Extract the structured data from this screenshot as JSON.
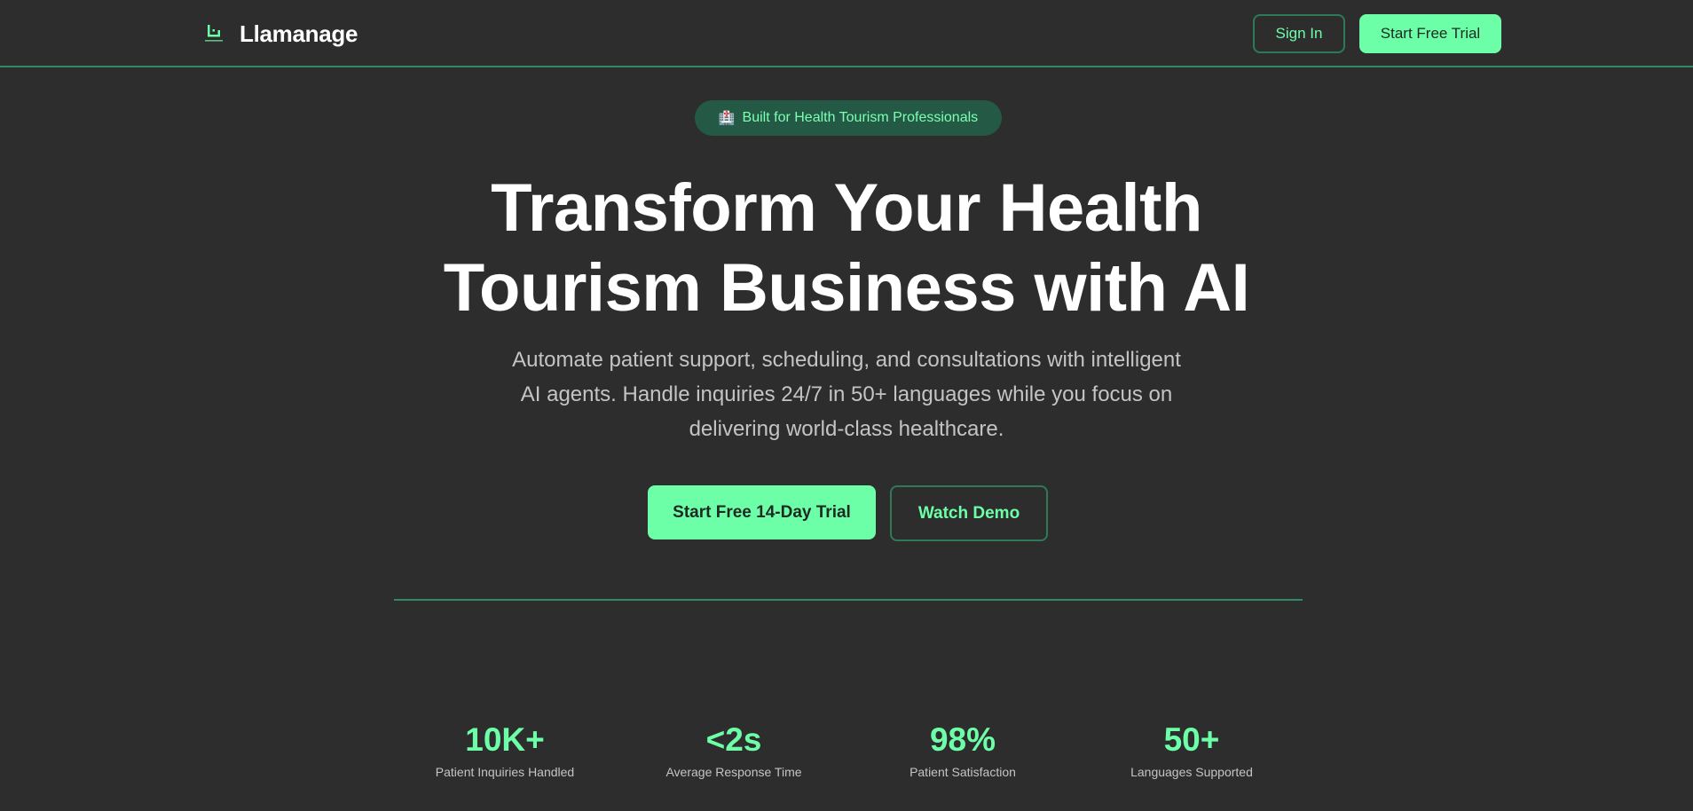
{
  "nav": {
    "brand_name": "Llamanage",
    "sign_in_label": "Sign In",
    "start_trial_label": "Start Free Trial"
  },
  "hero": {
    "badge_icon": "hospital-icon",
    "badge_text": "Built for Health Tourism Professionals",
    "headline": "Transform Your Health Tourism Business with AI",
    "subheadline": "Automate patient support, scheduling, and consultations with intelligent AI agents. Handle inquiries 24/7 in 50+ languages while you focus on delivering world-class healthcare.",
    "primary_cta": "Start Free 14-Day Trial",
    "secondary_cta": "Watch Demo"
  },
  "stats": [
    {
      "value": "10K+",
      "label": "Patient Inquiries Handled"
    },
    {
      "value": "<2s",
      "label": "Average Response Time"
    },
    {
      "value": "98%",
      "label": "Patient Satisfaction"
    },
    {
      "value": "50+",
      "label": "Languages Supported"
    }
  ],
  "colors": {
    "background": "#2d2d2d",
    "accent": "#6dffa8",
    "accent_dark": "#245a45",
    "border": "#2f8a63"
  }
}
